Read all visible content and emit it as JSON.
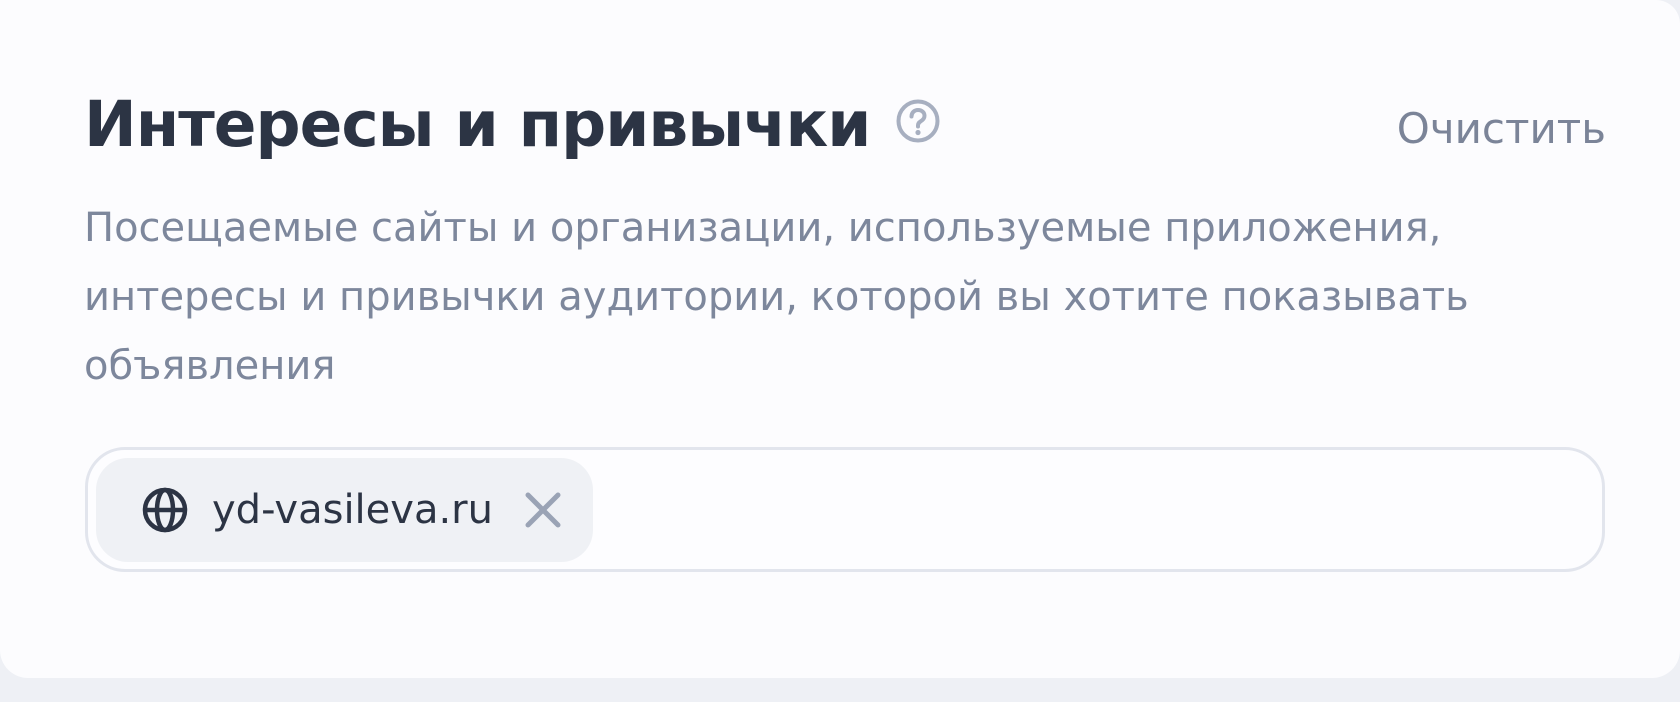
{
  "section": {
    "title": "Интересы и привычки",
    "clear_label": "Очистить",
    "description": "Посещаемые сайты и организации, используемые приложения, интересы и привычки аудитории, которой вы хотите показывать объявления",
    "tags": [
      {
        "label": "yd-vasileva.ru",
        "icon": "globe-icon"
      }
    ]
  },
  "colors": {
    "title": "#2c3444",
    "muted_text": "#7d879c",
    "chip_background": "#eff1f5",
    "field_border": "#e2e5ed",
    "card_background": "#fcfcfe",
    "page_background": "#eef0f5"
  }
}
